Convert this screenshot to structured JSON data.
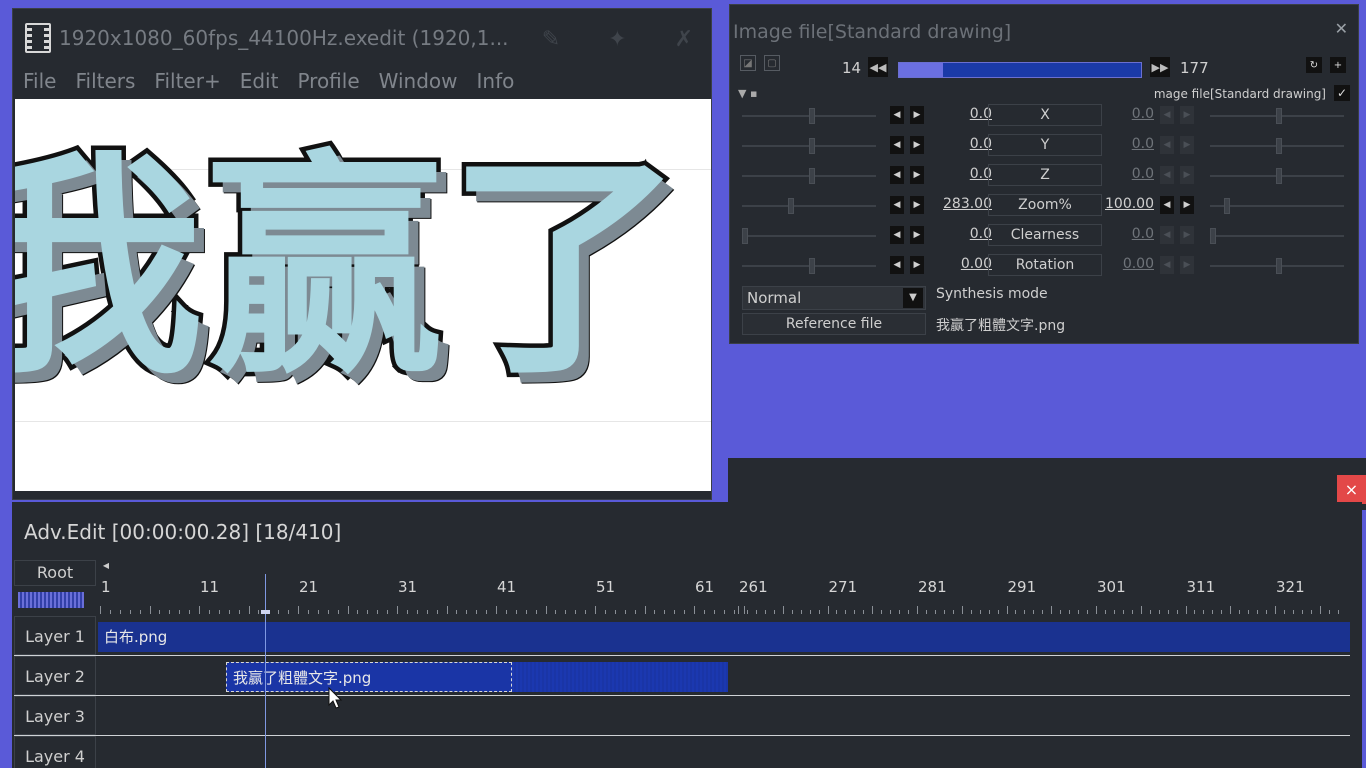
{
  "main_window": {
    "title": "1920x1080_60fps_44100Hz.exedit (1920,1...",
    "menu": [
      "File",
      "Filters",
      "Filter+",
      "Edit",
      "Profile",
      "Window",
      "Info"
    ],
    "preview_text": "我赢了"
  },
  "properties": {
    "title": "Image file[Standard drawing]",
    "frame_start": "14",
    "frame_end": "177",
    "frame_progress": 0.18,
    "section_label": "mage file[Standard drawing]",
    "section_checked": true,
    "params": [
      {
        "label": "X",
        "start": "0.0",
        "end": "0.0",
        "end_active": false
      },
      {
        "label": "Y",
        "start": "0.0",
        "end": "0.0",
        "end_active": false
      },
      {
        "label": "Z",
        "start": "0.0",
        "end": "0.0",
        "end_active": false
      },
      {
        "label": "Zoom%",
        "start": "283.00",
        "end": "100.00",
        "end_active": true
      },
      {
        "label": "Clearness",
        "start": "0.0",
        "end": "0.0",
        "end_active": false
      },
      {
        "label": "Rotation",
        "start": "0.00",
        "end": "0.00",
        "end_active": false
      }
    ],
    "blend_mode": "Normal",
    "synthesis_label": "Synthesis mode",
    "reference_button": "Reference file",
    "reference_file": "我赢了粗體文字.png"
  },
  "timeline": {
    "title": "Adv.Edit [00:00:00.28] [18/410]",
    "root_label": "Root",
    "ruler_labels": [
      "1",
      "11",
      "21",
      "31",
      "41",
      "51",
      "61",
      "261",
      "271",
      "281",
      "291",
      "301",
      "311",
      "321"
    ],
    "layers": [
      "Layer 1",
      "Layer 2",
      "Layer 3",
      "Layer 4"
    ],
    "clips": {
      "layer1": "白布.png",
      "layer2": "我赢了粗體文字.png"
    },
    "close_label": "×"
  },
  "colors": {
    "background": "#5a5ad8",
    "panel": "#262a30",
    "clip": "#1a35a6",
    "accent": "#6b6fe0",
    "close": "#e34848"
  },
  "icons": [
    "film-icon",
    "pen-icon",
    "magic-icon",
    "wrench-icon",
    "rewind-icon",
    "fast-forward-icon",
    "chevron-down-icon",
    "check-icon",
    "close-icon",
    "cursor-icon"
  ]
}
